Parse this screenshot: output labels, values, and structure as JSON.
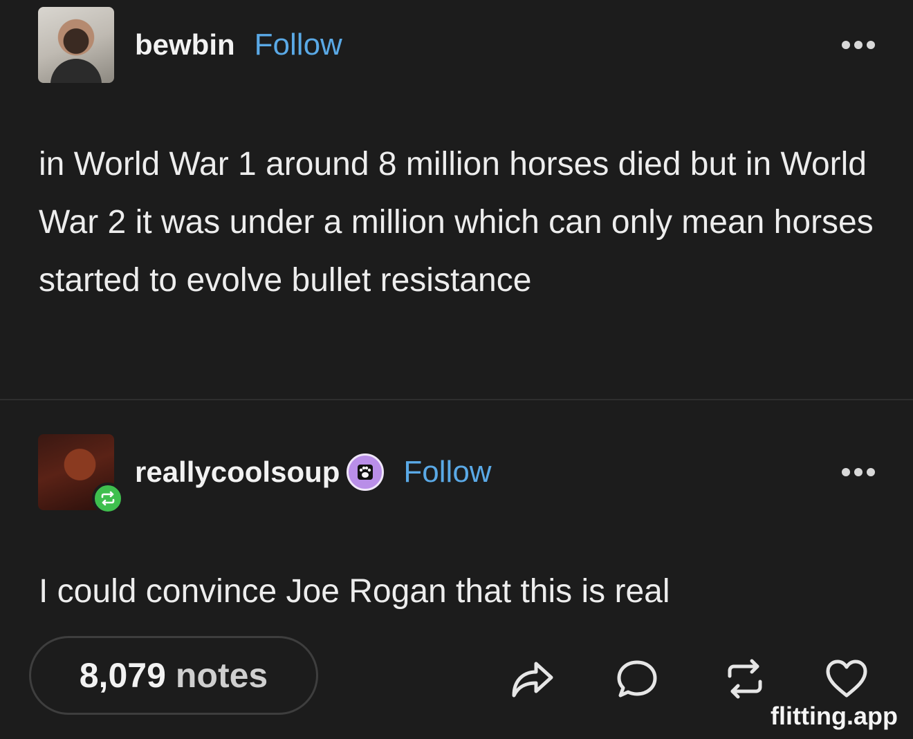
{
  "posts": [
    {
      "username": "bewbin",
      "follow_label": "Follow",
      "body": "in World War 1 around 8 million horses died but in World War 2 it was under a million which can only mean horses started to evolve bullet resistance"
    },
    {
      "username": "reallycoolsoup",
      "follow_label": "Follow",
      "body": "I could convince Joe Rogan that this is real"
    }
  ],
  "footer": {
    "notes_count": "8,079",
    "notes_label": "notes",
    "actions": [
      "share-icon",
      "reply-icon",
      "reblog-icon",
      "like-icon"
    ]
  },
  "watermark": "flitting.app",
  "colors": {
    "background": "#1c1c1c",
    "follow": "#5aa9e6",
    "reblog_badge": "#3fbf4e"
  }
}
